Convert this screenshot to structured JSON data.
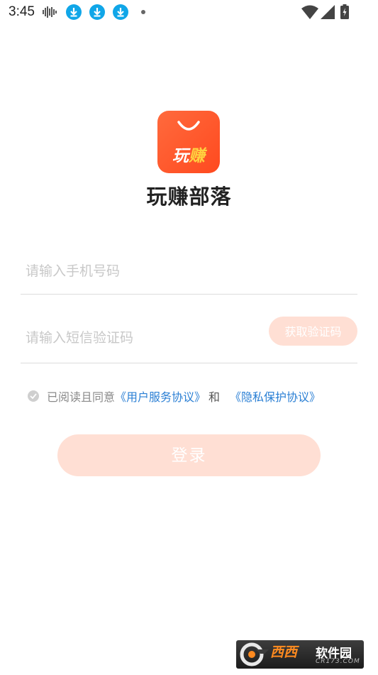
{
  "status_bar": {
    "time": "3:45",
    "icons": [
      "waveform-icon",
      "download-icon",
      "download-icon",
      "download-icon",
      "dot-icon",
      "wifi-icon",
      "signal-icon",
      "battery-icon"
    ]
  },
  "app": {
    "logo_text_left": "玩",
    "logo_text_right": "赚",
    "name": "玩赚部落"
  },
  "form": {
    "phone_placeholder": "请输入手机号码",
    "sms_placeholder": "请输入短信验证码",
    "get_code_label": "获取验证码",
    "agreement_prefix": "已阅读且同意",
    "user_agreement": "《用户服务协议》",
    "agreement_and": "和",
    "privacy_agreement": "《隐私保护协议》",
    "login_label": "登录"
  },
  "watermark": {
    "brand_orange": "西西",
    "brand_white": "软件园",
    "url": "CR173.COM"
  },
  "colors": {
    "accent": "#ff5a2a",
    "button_disabled": "#ffdfd4",
    "link": "#2a7fd4",
    "download_badge": "#10a6e8"
  }
}
